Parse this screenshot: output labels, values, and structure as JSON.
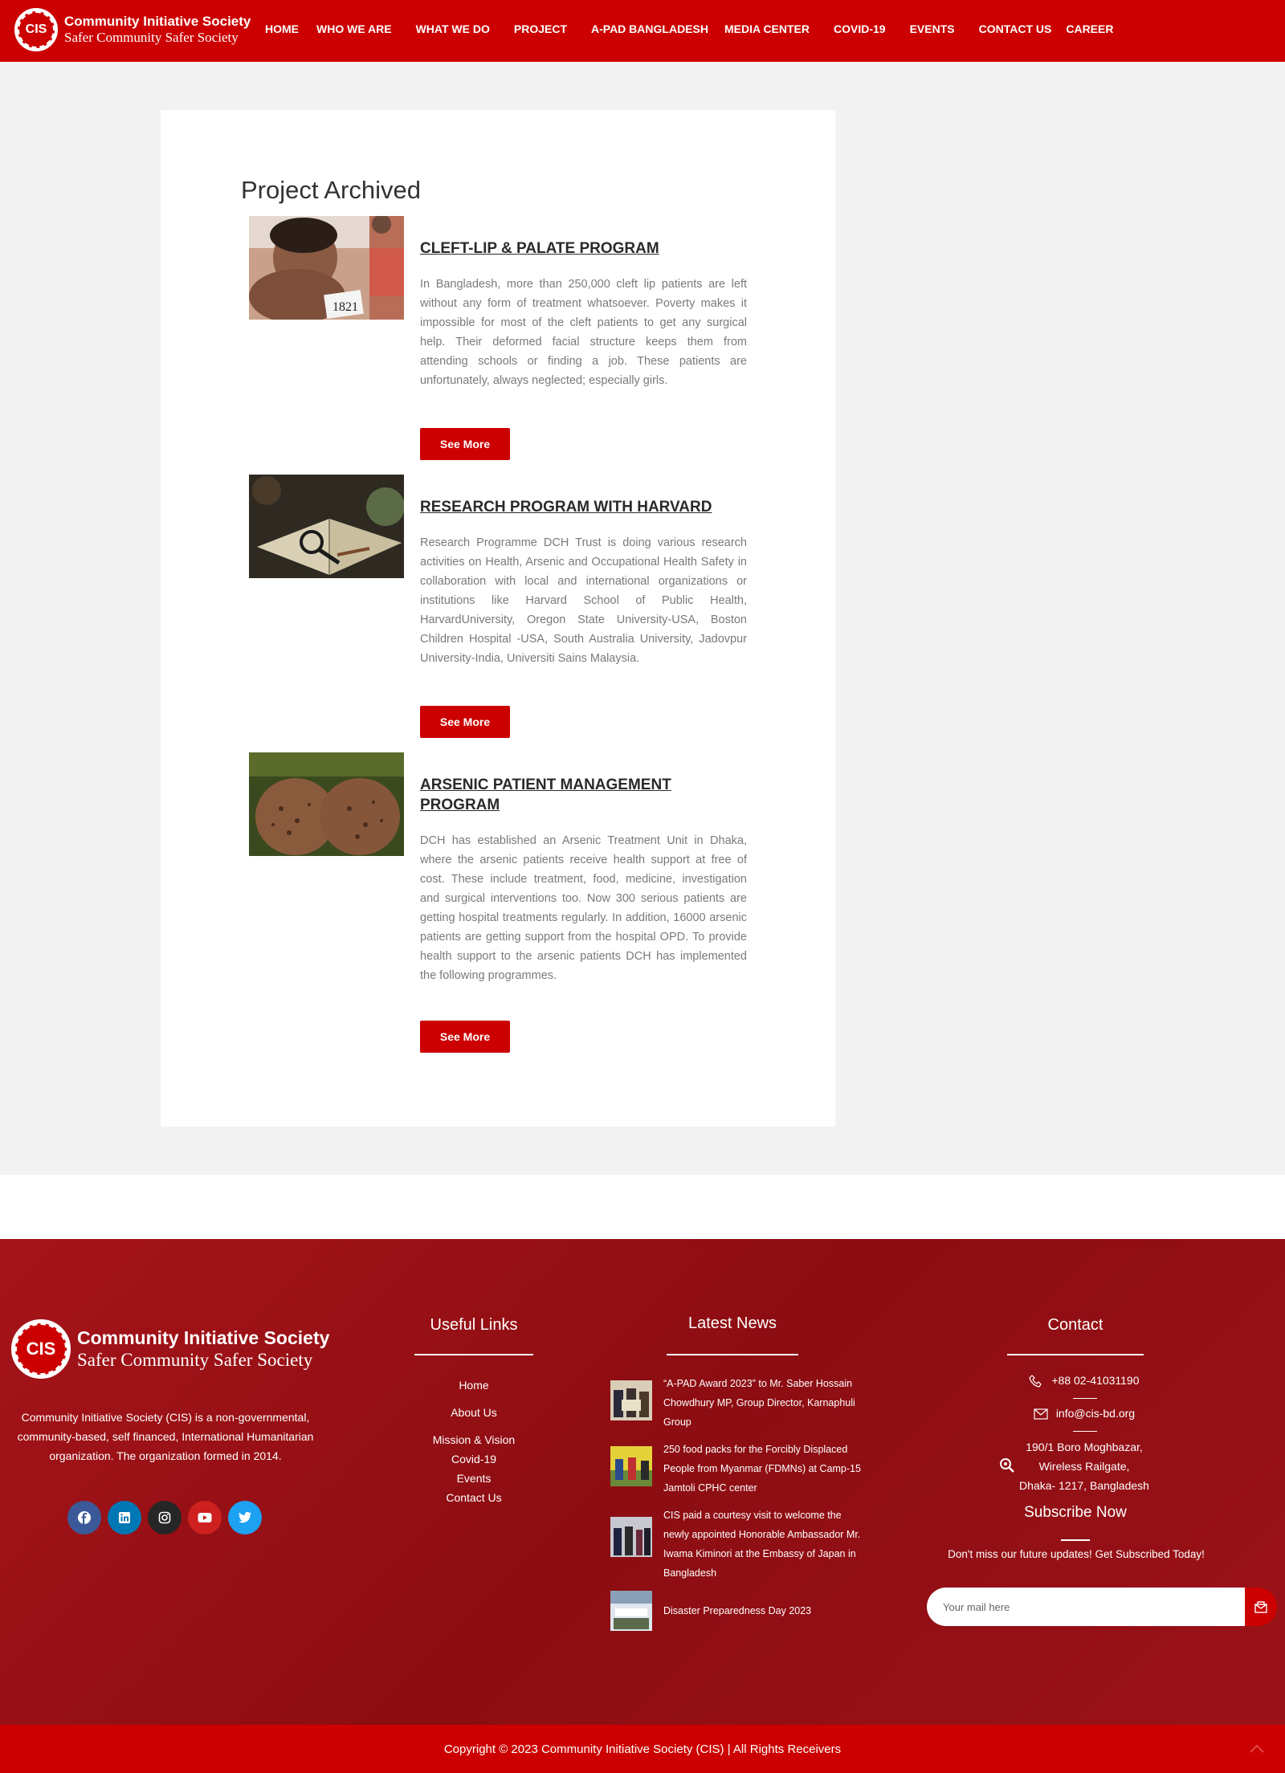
{
  "brand": {
    "logo_text": "CIS",
    "title": "Community Initiative Society",
    "tagline": "Safer Community Safer Society"
  },
  "nav": [
    {
      "label": "HOME"
    },
    {
      "label": "WHO WE ARE"
    },
    {
      "label": "WHAT WE DO"
    },
    {
      "label": "PROJECT"
    },
    {
      "label": "A-PAD BANGLADESH"
    },
    {
      "label": "MEDIA CENTER"
    },
    {
      "label": "COVID-19"
    },
    {
      "label": "EVENTS"
    },
    {
      "label": "CONTACT US"
    },
    {
      "label": "CAREER"
    }
  ],
  "main": {
    "title": "Project Archived",
    "projects": [
      {
        "title": "CLEFT-LIP & PALATE PROGRAM",
        "description": "In Bangladesh, more than 250,000 cleft lip patients are left without any form of treatment whatsoever. Poverty makes it impossible for most of the cleft patients to get any surgical help. Their deformed facial structure keeps them from attending schools or finding a job. These patients are unfortunately, always neglected; especially girls.",
        "button": "See More",
        "thumb_label": "1821"
      },
      {
        "title": "RESEARCH PROGRAM WITH HARVARD",
        "description": "Research Programme DCH Trust is doing various research activities on Health, Arsenic and Occupational Health Safety in collaboration with local and international organizations or institutions like Harvard School of Public Health, HarvardUniversity, Oregon State University-USA, Boston Children Hospital -USA, South Australia University, Jadovpur University-India, Universiti Sains Malaysia.",
        "button": "See More"
      },
      {
        "title": "ARSENIC PATIENT MANAGEMENT PROGRAM",
        "description": "DCH has established an Arsenic Treatment Unit in Dhaka, where the arsenic patients receive health support at free of cost. These include treatment, food, medicine, investigation and surgical interventions too. Now 300 serious patients are getting hospital treatments regularly. In addition, 16000 arsenic patients are getting support from the hospital OPD. To provide health support to the arsenic patients DCH has implemented the following programmes.",
        "button": "See More"
      }
    ]
  },
  "footer": {
    "about": "Community Initiative Society (CIS) is a non-governmental, community-based, self financed, International Humanitarian organization. The organization formed in 2014.",
    "socials": [
      {
        "name": "facebook-icon",
        "color": "#3b5998"
      },
      {
        "name": "linkedin-icon",
        "color": "#0077b5"
      },
      {
        "name": "instagram-icon",
        "color": "#262626"
      },
      {
        "name": "youtube-icon",
        "color": "#cd201f"
      },
      {
        "name": "twitter-icon",
        "color": "#1da1f2"
      }
    ],
    "useful_links_title": "Useful Links",
    "useful_links": [
      "Home",
      "About Us",
      "Mission & Vision",
      "Covid-19",
      "Events",
      "Contact Us"
    ],
    "news_title": "Latest News",
    "news": [
      "“A-PAD Award 2023” to Mr. Saber Hossain Chowdhury MP, Group Director, Karnaphuli Group",
      "250 food packs for the Forcibly Displaced People from Myanmar (FDMNs) at Camp-15 Jamtoli CPHC center",
      "CIS paid a courtesy visit to welcome the newly appointed Honorable Ambassador Mr. Iwama Kiminori at the Embassy of Japan in Bangladesh",
      "Disaster Preparedness Day 2023"
    ],
    "contact_title": "Contact",
    "phone": "+88 02-41031190",
    "email": "info@cis-bd.org",
    "address_1": "190/1 Boro Moghbazar,",
    "address_2": "Wireless Railgate,",
    "address_3": "Dhaka- 1217, Bangladesh",
    "subscribe_title": "Subscribe Now",
    "subscribe_text": "Don't miss our future updates! Get Subscribed Today!",
    "subscribe_placeholder": "Your mail here",
    "copyright": "Copyright © 2023 Community Initiative Society (CIS) | All Rights Receivers"
  },
  "colors": {
    "brand_red": "#cc0000",
    "footer_red": "#9a1218"
  }
}
